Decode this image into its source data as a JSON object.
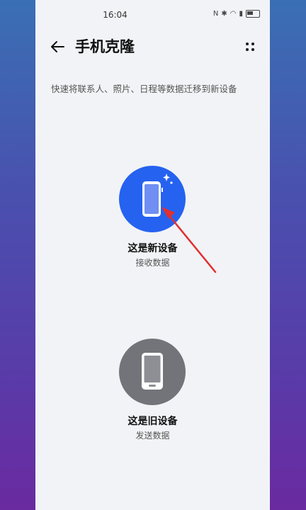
{
  "status_bar": {
    "time": "16:04",
    "icons": [
      "nfc-icon",
      "bluetooth-icon",
      "wifi-icon",
      "sim-icon",
      "battery-icon"
    ]
  },
  "header": {
    "title": "手机克隆",
    "back_icon": "back-arrow-icon",
    "more_icon": "more-dots-icon"
  },
  "description": "快速将联系人、照片、日程等数据迁移到新设备",
  "options": [
    {
      "label": "这是新设备",
      "sublabel": "接收数据",
      "icon": "new-phone-icon",
      "color": "#2562f0"
    },
    {
      "label": "这是旧设备",
      "sublabel": "发送数据",
      "icon": "old-phone-icon",
      "color": "#72747a"
    }
  ],
  "annotation": {
    "icon": "red-arrow-annotation",
    "color": "#e03030"
  }
}
